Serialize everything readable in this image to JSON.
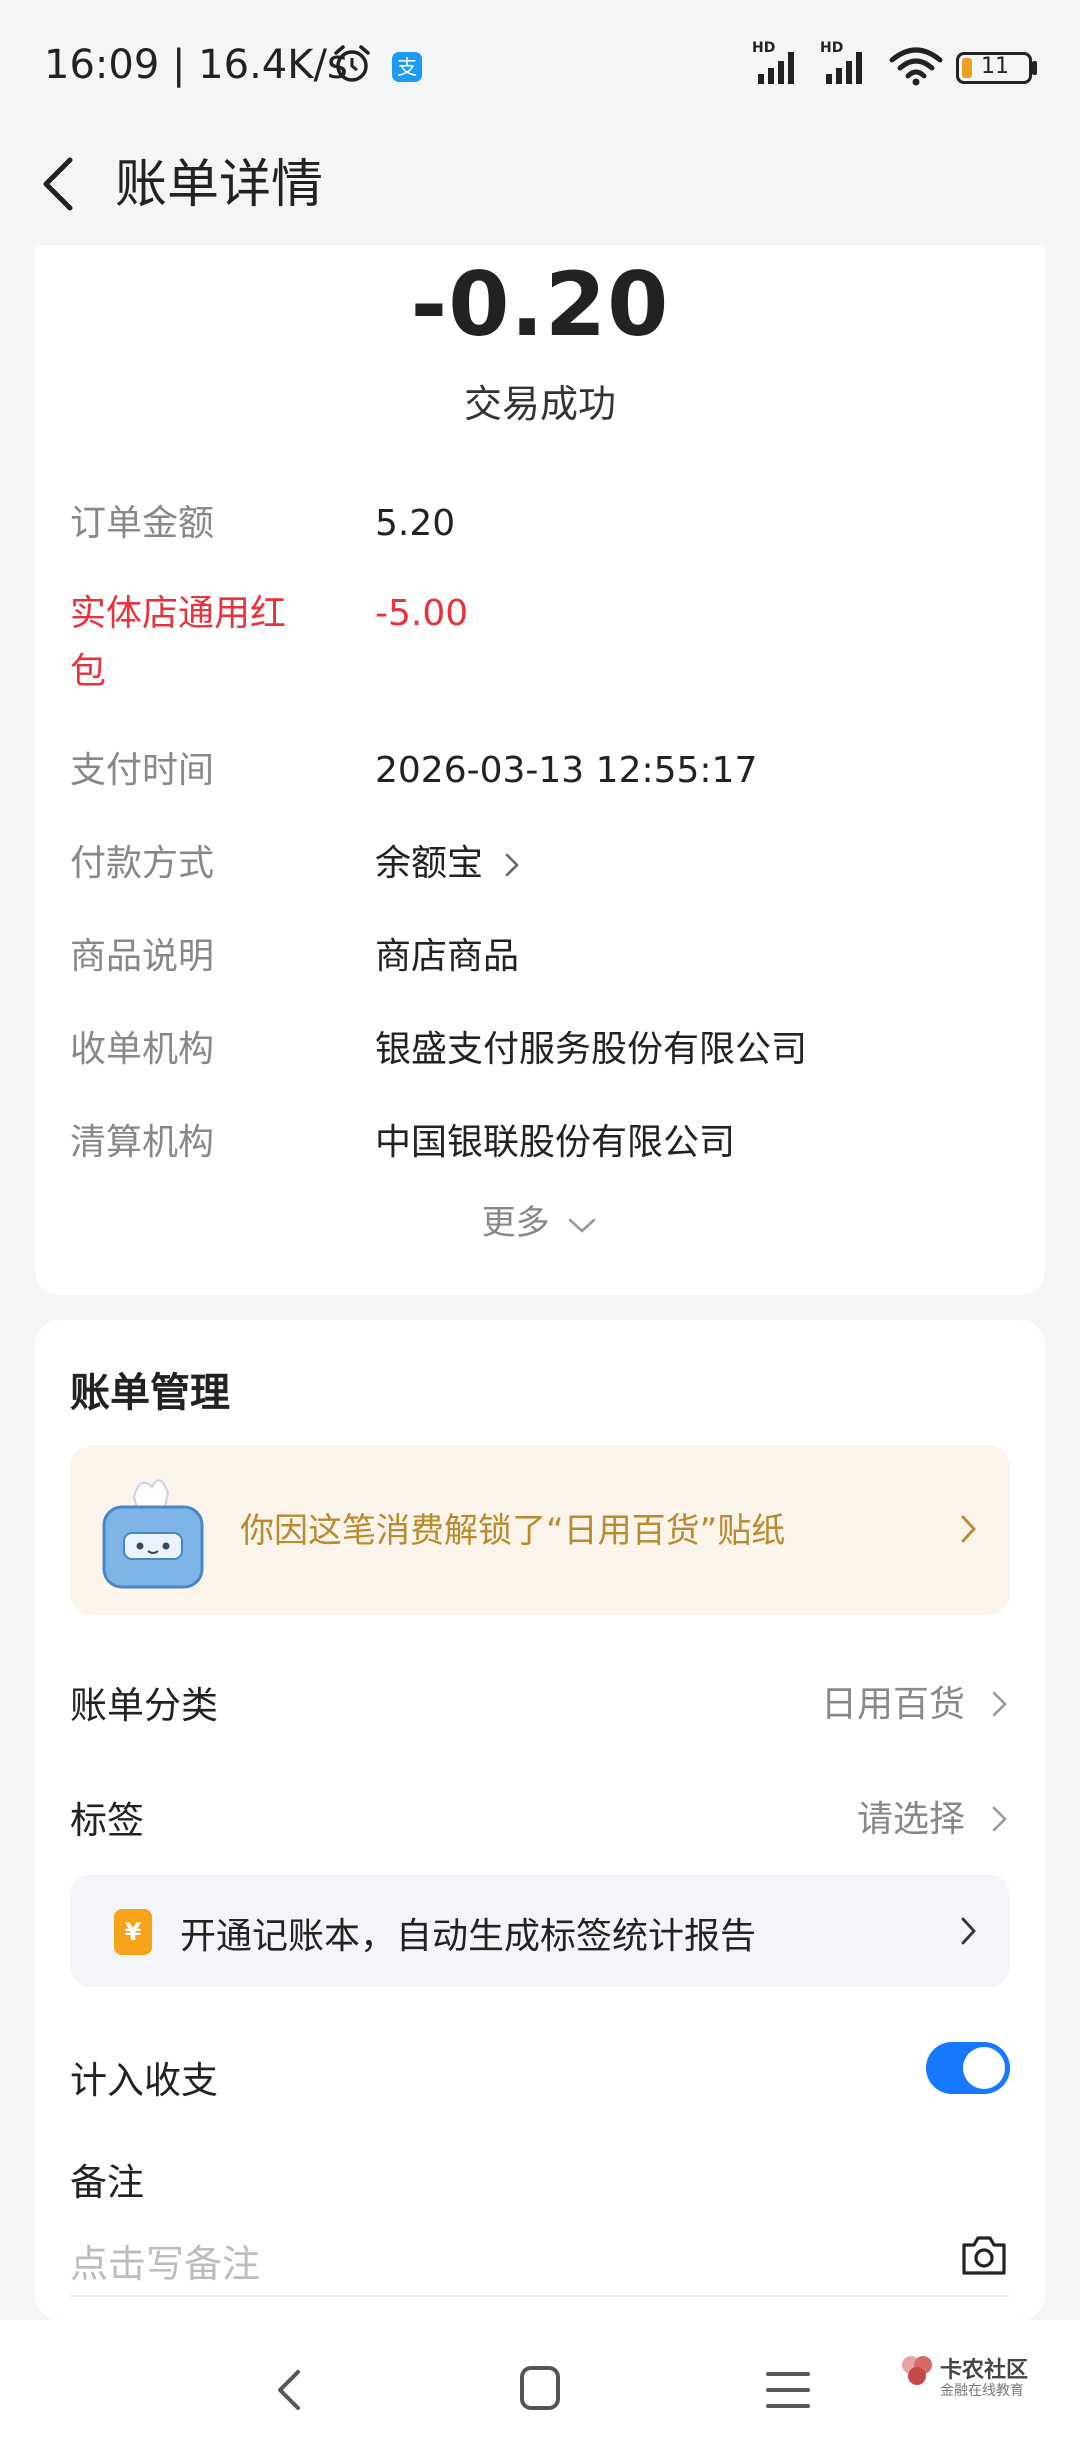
{
  "status_bar": {
    "time": "16:09 | 16.4K/s",
    "battery": "11",
    "alipay_glyph": "支",
    "signal_badge": "HD"
  },
  "header": {
    "title": "账单详情"
  },
  "summary": {
    "amount": "-0.20",
    "status": "交易成功"
  },
  "details": [
    {
      "label": "订单金额",
      "value": "5.20"
    },
    {
      "label": "实体店通用红包",
      "value": "-5.00",
      "highlight": "#e8323c"
    },
    {
      "label": "支付时间",
      "value": "2026-03-13 12:55:17"
    },
    {
      "label": "付款方式",
      "value": "余额宝"
    },
    {
      "label": "商品说明",
      "value": "商店商品"
    },
    {
      "label": "收单机构",
      "value": "银盛支付服务股份有限公司"
    },
    {
      "label": "清算机构",
      "value": "中国银联股份有限公司"
    }
  ],
  "more_label": "更多",
  "management": {
    "title": "账单管理",
    "sticker_text": "你因这笔消费解锁了“日用百货”贴纸",
    "category_label": "账单分类",
    "category_value": "日用百货",
    "tag_label": "标签",
    "tag_value": "请选择",
    "ledger_icon": "¥",
    "ledger_text": "开通记账本，自动生成标签统计报告",
    "include_label": "计入收支",
    "include_on": true,
    "note_label": "备注",
    "note_placeholder": "点击写备注"
  },
  "watermark": {
    "line1": "卡农社区",
    "line2": "金融在线教育"
  },
  "colors": {
    "accent": "#1677ff",
    "red": "#e8323c",
    "gold": "#b98a2e"
  }
}
